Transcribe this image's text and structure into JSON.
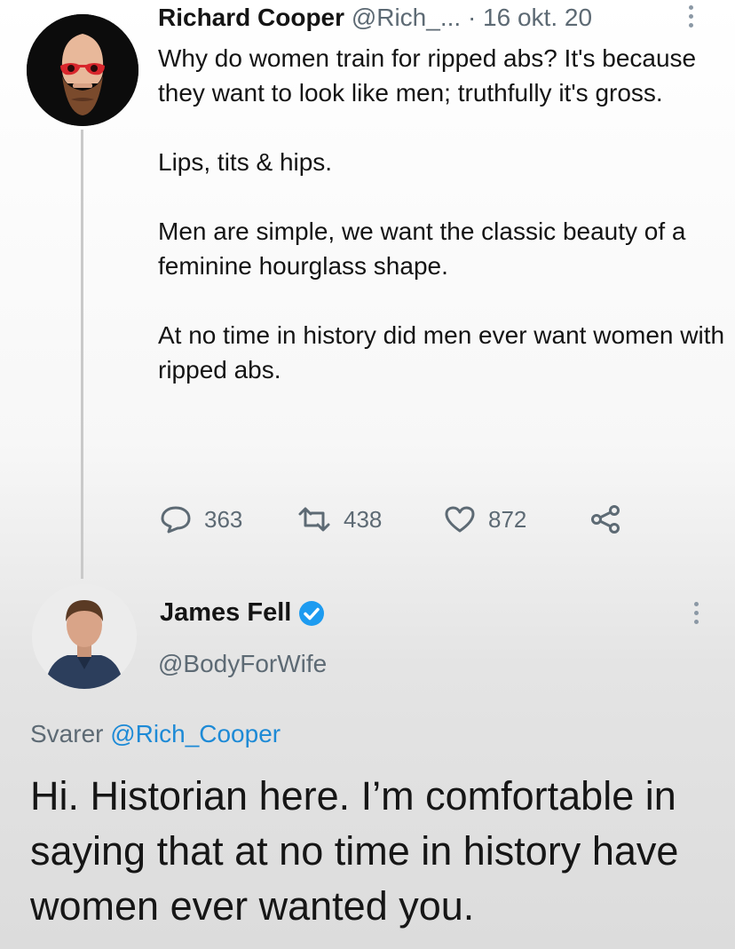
{
  "tweet": {
    "author_name": "Richard Cooper",
    "author_handle": "@Rich_...",
    "date": "· 16 okt. 20",
    "paragraphs": [
      "Why do women train for ripped abs? It's because they want to look like men; truthfully it's gross.",
      "Lips, tits & hips.",
      "Men are simple, we want the classic beauty of a feminine hourglass shape.",
      "At no time in history did men ever want women with ripped abs."
    ],
    "stats": {
      "replies": "363",
      "retweets": "438",
      "likes": "872"
    }
  },
  "reply": {
    "author_name": "James Fell",
    "author_handle": "@BodyForWife",
    "replying_label": "Svarer",
    "replying_to": "@Rich_Cooper",
    "text": "Hi. Historian here. I’m comfortable in saying that at no time in history have women ever wanted you."
  },
  "colors": {
    "verified": "#1d9bf0",
    "mention": "#1d8ad6",
    "secondary_text": "#5d6a74"
  },
  "icons": [
    "reply-icon",
    "retweet-icon",
    "like-icon",
    "share-icon",
    "verified-icon",
    "more-icon"
  ]
}
